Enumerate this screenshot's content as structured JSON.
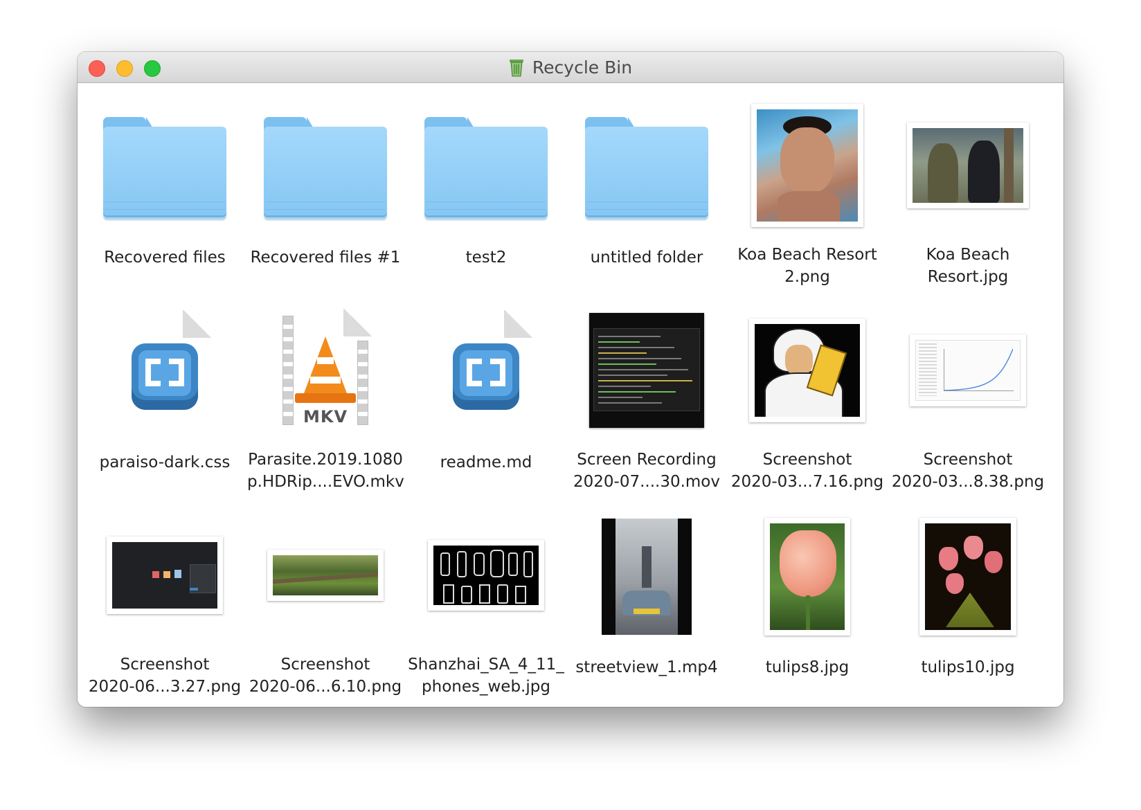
{
  "window": {
    "title": "Recycle Bin"
  },
  "items": [
    {
      "name": "Recovered files",
      "kind": "folder"
    },
    {
      "name": "Recovered files #1",
      "kind": "folder"
    },
    {
      "name": "test2",
      "kind": "folder"
    },
    {
      "name": "untitled folder",
      "kind": "folder"
    },
    {
      "name": "Koa Beach Resort\n2.png",
      "kind": "photo"
    },
    {
      "name": "Koa Beach\nResort.jpg",
      "kind": "photo"
    },
    {
      "name": "paraiso-dark.css",
      "kind": "brackets-document"
    },
    {
      "name": "Parasite.2019.1080\np.HDRip....EVO.mkv",
      "kind": "vlc-video-document",
      "badge": "MKV"
    },
    {
      "name": "readme.md",
      "kind": "brackets-document"
    },
    {
      "name": "Screen Recording\n2020-07....30.mov",
      "kind": "video-thumbnail"
    },
    {
      "name": "Screenshot\n2020-03...7.16.png",
      "kind": "image-thumbnail"
    },
    {
      "name": "Screenshot\n2020-03...8.38.png",
      "kind": "image-thumbnail"
    },
    {
      "name": "Screenshot\n2020-06...3.27.png",
      "kind": "image-thumbnail"
    },
    {
      "name": "Screenshot\n2020-06...6.10.png",
      "kind": "image-thumbnail"
    },
    {
      "name": "Shanzhai_SA_4_11_\nphones_web.jpg",
      "kind": "image-thumbnail"
    },
    {
      "name": "streetview_1.mp4",
      "kind": "video-thumbnail"
    },
    {
      "name": "tulips8.jpg",
      "kind": "photo"
    },
    {
      "name": "tulips10.jpg",
      "kind": "photo"
    }
  ],
  "colors": {
    "folder": "#8fcdf6",
    "close": "#fe5f57",
    "minimize": "#febc2e",
    "zoom": "#28c840"
  }
}
